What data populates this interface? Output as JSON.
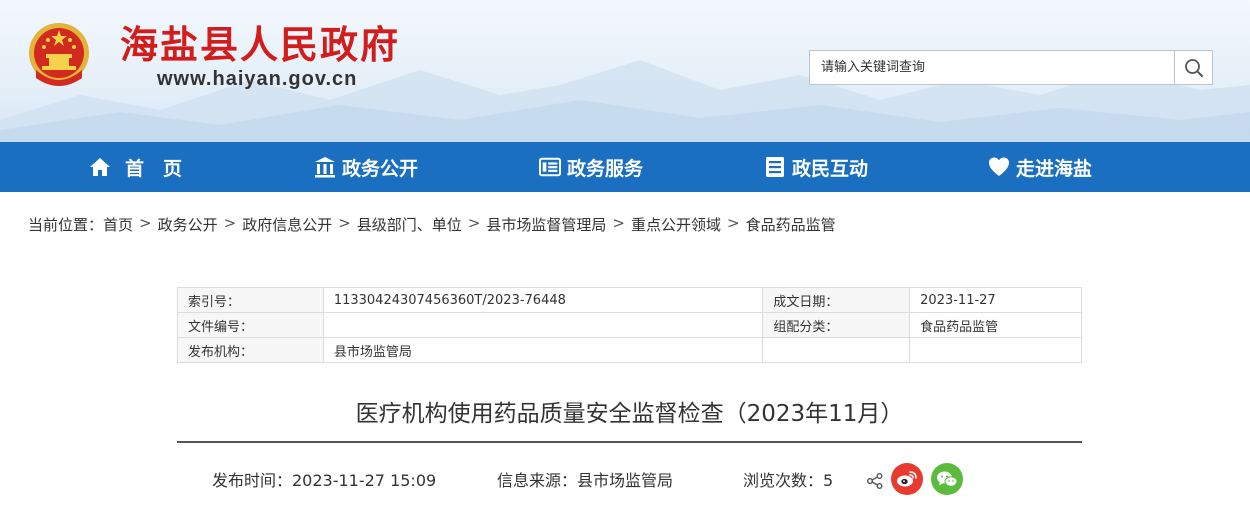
{
  "header": {
    "site_title": "海盐县人民政府",
    "site_url": "www.haiyan.gov.cn",
    "search_placeholder": "请输入关键词查询"
  },
  "nav": {
    "items": [
      {
        "label": "首　页",
        "icon": "home-icon"
      },
      {
        "label": "政务公开",
        "icon": "government-building-icon"
      },
      {
        "label": "政务服务",
        "icon": "service-list-icon"
      },
      {
        "label": "政民互动",
        "icon": "interaction-list-icon"
      },
      {
        "label": "走进海盐",
        "icon": "heart-icon"
      }
    ]
  },
  "breadcrumb": {
    "prefix": "当前位置：",
    "items": [
      "首页",
      "政务公开",
      "政府信息公开",
      "县级部门、单位",
      "县市场监督管理局",
      "重点公开领域",
      "食品药品监管"
    ],
    "separator": ">"
  },
  "meta": {
    "index_label": "索引号：",
    "index_value": "11330424307456360T/2023-76448",
    "date_label": "成文日期：",
    "date_value": "2023-11-27",
    "docno_label": "文件编号：",
    "docno_value": "",
    "category_label": "组配分类：",
    "category_value": "食品药品监管",
    "publisher_label": "发布机构：",
    "publisher_value": "县市场监管局"
  },
  "article": {
    "title": "医疗机构使用药品质量安全监督检查（2023年11月）",
    "publish_time": "发布时间：2023-11-27 15:09",
    "source": "信息来源：县市场监管局",
    "views": "浏览次数：5"
  },
  "colors": {
    "brand_red": "#d21d1d",
    "nav_blue": "#1a6fc1",
    "weibo_red": "#e63b2e",
    "wechat_green": "#5bbb3c"
  }
}
